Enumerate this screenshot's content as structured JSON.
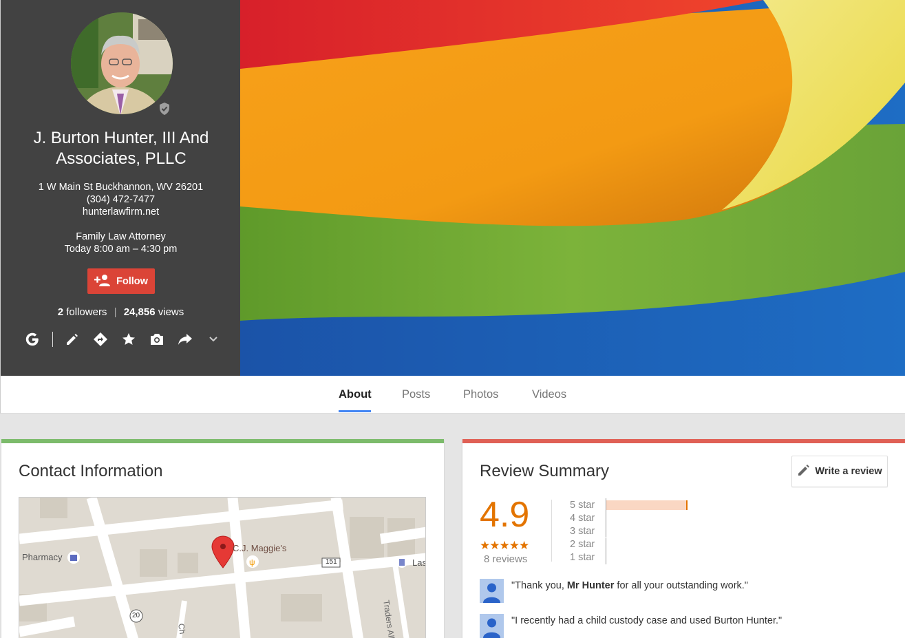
{
  "profile": {
    "name": "J. Burton Hunter, III And Associates, PLLC",
    "address": "1 W Main St Buckhannon, WV 26201",
    "phone": "(304) 472-7477",
    "website": "hunterlawfirm.net",
    "category": "Family Law Attorney",
    "hours": "Today 8:00 am – 4:30 pm",
    "follow_label": "Follow",
    "followers_count": "2",
    "followers_label": "followers",
    "views_count": "24,856",
    "views_label": "views",
    "actions": [
      "google-icon",
      "edit-icon",
      "directions-icon",
      "star-icon",
      "camera-icon",
      "share-icon",
      "chevron-down-icon"
    ]
  },
  "tabs": [
    {
      "label": "About",
      "active": true
    },
    {
      "label": "Posts",
      "active": false
    },
    {
      "label": "Photos",
      "active": false
    },
    {
      "label": "Videos",
      "active": false
    }
  ],
  "contact": {
    "title": "Contact Information",
    "map_labels": {
      "pharmacy": "Pharmacy",
      "place": "C.J. Maggie's",
      "route_151": "151",
      "route_20": "20",
      "street_traders": "Traders Alley",
      "street_ch": "Ch",
      "las": "Las"
    }
  },
  "reviews": {
    "title": "Review Summary",
    "write_label": "Write a review",
    "score": "4.9",
    "stars": "★★★★★",
    "count": "8 reviews",
    "distribution": [
      {
        "label": "5 star",
        "fraction": 0.74
      },
      {
        "label": "4 star",
        "fraction": 0
      },
      {
        "label": "3 star",
        "fraction": 0
      },
      {
        "label": "2 star",
        "fraction": 0
      },
      {
        "label": "1 star",
        "fraction": 0
      }
    ],
    "snippets": [
      {
        "before": "\"Thank you, ",
        "bold": "Mr Hunter",
        "after": " for all your outstanding work.\""
      },
      {
        "before": "\"I recently had a child custody case and used Burton Hunter.\"",
        "bold": "",
        "after": ""
      }
    ]
  },
  "colors": {
    "panel": "#424242",
    "follow": "#db4437",
    "accent_orange": "#e37400",
    "tab_underline": "#4285f4",
    "contact_border": "#7cbb6b",
    "review_border": "#e06055"
  }
}
